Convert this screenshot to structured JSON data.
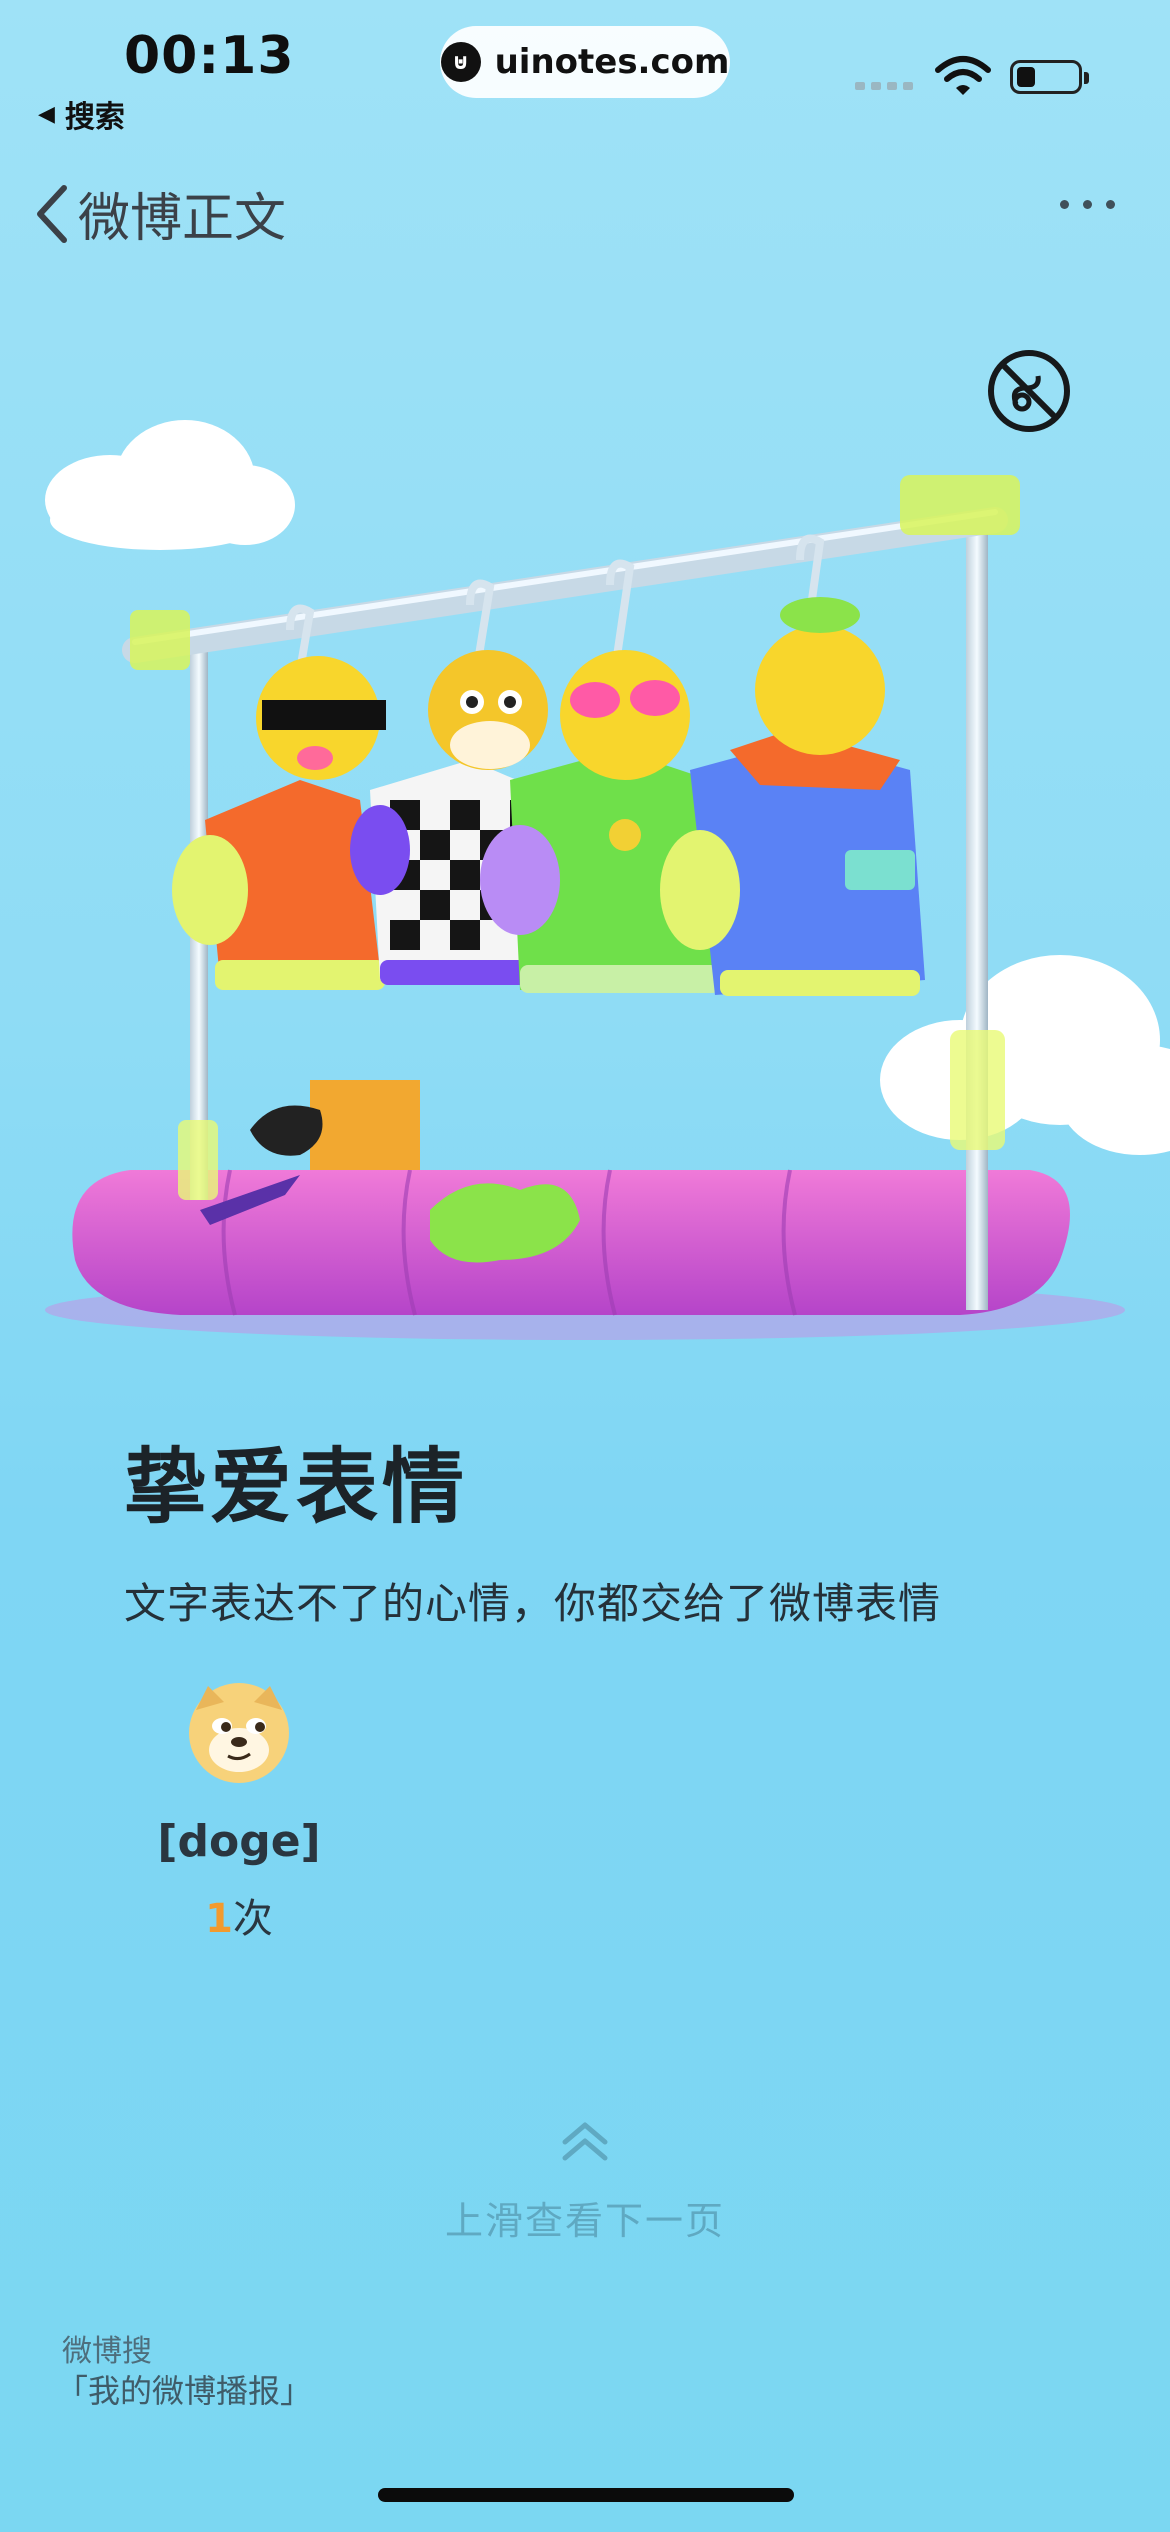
{
  "status_bar": {
    "time": "00:13",
    "back_app_label": "搜索",
    "url": "uinotes.com"
  },
  "nav": {
    "title": "微博正文"
  },
  "content": {
    "title": "挚爱表情",
    "subtitle": "文字表达不了的心情，你都交给了微博表情",
    "emoji": {
      "name": "[doge]",
      "count": "1",
      "count_unit": "次"
    }
  },
  "swipe": {
    "label": "上滑查看下一页"
  },
  "footer": {
    "line1": "微博搜",
    "line2": "「我的微博播报」"
  },
  "icons": {
    "back": "chevron-left-icon",
    "more": "more-dots-icon",
    "sound_off": "no-animation-icon",
    "swipe": "double-chevron-up-icon",
    "wifi": "wifi-icon",
    "battery": "battery-icon"
  },
  "colors": {
    "background_top": "#9fe2f7",
    "background_bottom": "#7bd7f2",
    "count_accent": "#f29a2e",
    "swipe_hint": "#5fa9c2"
  }
}
